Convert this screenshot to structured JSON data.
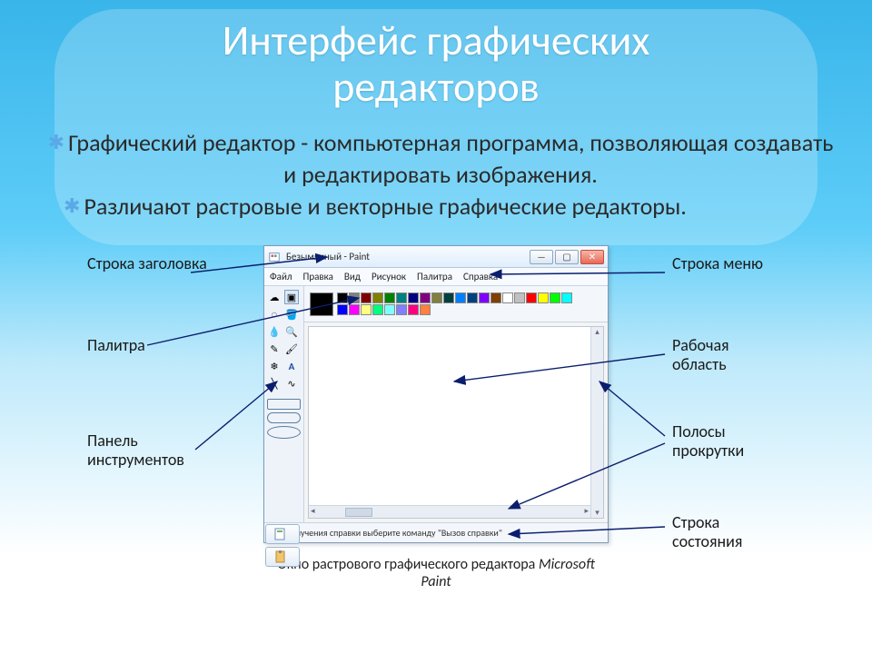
{
  "slide": {
    "title_line1": "Интерфейс графических",
    "title_line2": "редакторов",
    "para1_lead": "Графический редактор",
    "para1_rest": " - компьютерная программа, позволяющая создавать и редактировать изображения.",
    "para2": "Различают растровые и векторные графические редакторы."
  },
  "annotations": {
    "title_bar": "Строка заголовка",
    "palette": "Палитра",
    "toolbox": "Панель инструментов",
    "menu_bar": "Строка меню",
    "work_area": "Рабочая область",
    "scrollbars": "Полосы прокрутки",
    "status_bar": "Строка состояния"
  },
  "paint": {
    "window_title": "Безымянный - Paint",
    "menus": [
      "Файл",
      "Правка",
      "Вид",
      "Рисунок",
      "Палитра",
      "Справка"
    ],
    "status_text": "Для получения справки выберите команду \"Вызов справки\"",
    "palette_colors": [
      "#000000",
      "#808080",
      "#800000",
      "#808000",
      "#008000",
      "#008080",
      "#000080",
      "#800080",
      "#808040",
      "#004040",
      "#0080ff",
      "#004080",
      "#8000ff",
      "#804000",
      "#ffffff",
      "#c0c0c0",
      "#ff0000",
      "#ffff00",
      "#00ff00",
      "#00ffff",
      "#0000ff",
      "#ff00ff",
      "#ffff80",
      "#00ff80",
      "#80ffff",
      "#8080ff",
      "#ff0080",
      "#ff8040"
    ],
    "tool_glyphs": [
      "✂",
      "▣",
      "◌",
      "✎",
      "🪣",
      "💧",
      "✎",
      "🔍",
      "🖊",
      "↗",
      "🖌",
      "A",
      "⬜",
      "⬭"
    ]
  },
  "caption_prefix": "Окно растрового графического редактора ",
  "caption_em": "Microsoft Paint"
}
